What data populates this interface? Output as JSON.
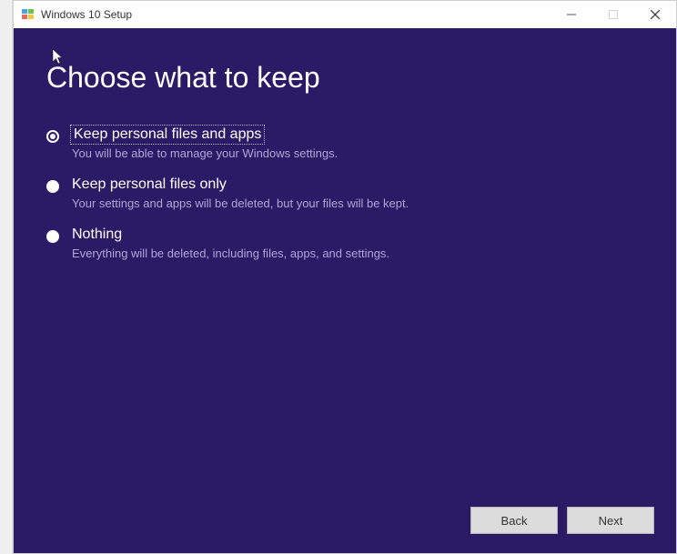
{
  "window": {
    "title": "Windows 10 Setup"
  },
  "page": {
    "heading": "Choose what to keep"
  },
  "options": [
    {
      "label": "Keep personal files and apps",
      "desc": "You will be able to manage your Windows settings.",
      "selected": true
    },
    {
      "label": "Keep personal files only",
      "desc": "Your settings and apps will be deleted, but your files will be kept.",
      "selected": false
    },
    {
      "label": "Nothing",
      "desc": "Everything will be deleted, including files, apps, and settings.",
      "selected": false
    }
  ],
  "buttons": {
    "back": "Back",
    "next": "Next"
  }
}
